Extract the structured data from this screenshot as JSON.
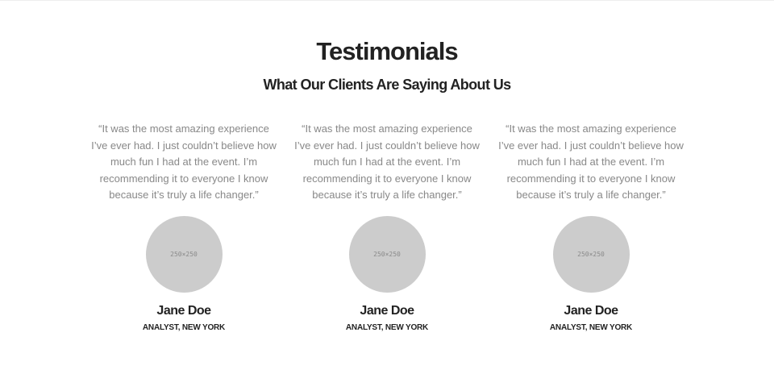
{
  "section": {
    "title": "Testimonials",
    "subtitle": "What Our Clients Are Saying About Us"
  },
  "testimonials": [
    {
      "quote": "“It was the most amazing experience I’ve ever had. I just couldn’t believe how much fun I had at the event. I’m recommending it to everyone I know because it’s truly a life changer.”",
      "avatar_label": "250×250",
      "name": "Jane Doe",
      "role": "ANALYST, NEW YORK"
    },
    {
      "quote": "“It was the most amazing experience I’ve ever had. I just couldn’t believe how much fun I had at the event. I’m recommending it to everyone I know because it’s truly a life changer.”",
      "avatar_label": "250×250",
      "name": "Jane Doe",
      "role": "ANALYST, NEW YORK"
    },
    {
      "quote": "“It was the most amazing experience I’ve ever had. I just couldn’t believe how much fun I had at the event. I’m recommending it to everyone I know because it’s truly a life changer.”",
      "avatar_label": "250×250",
      "name": "Jane Doe",
      "role": "ANALYST, NEW YORK"
    }
  ],
  "colors": {
    "heading": "#222222",
    "quote_text": "#888888",
    "avatar_placeholder": "#cccccc",
    "background": "#ffffff"
  }
}
